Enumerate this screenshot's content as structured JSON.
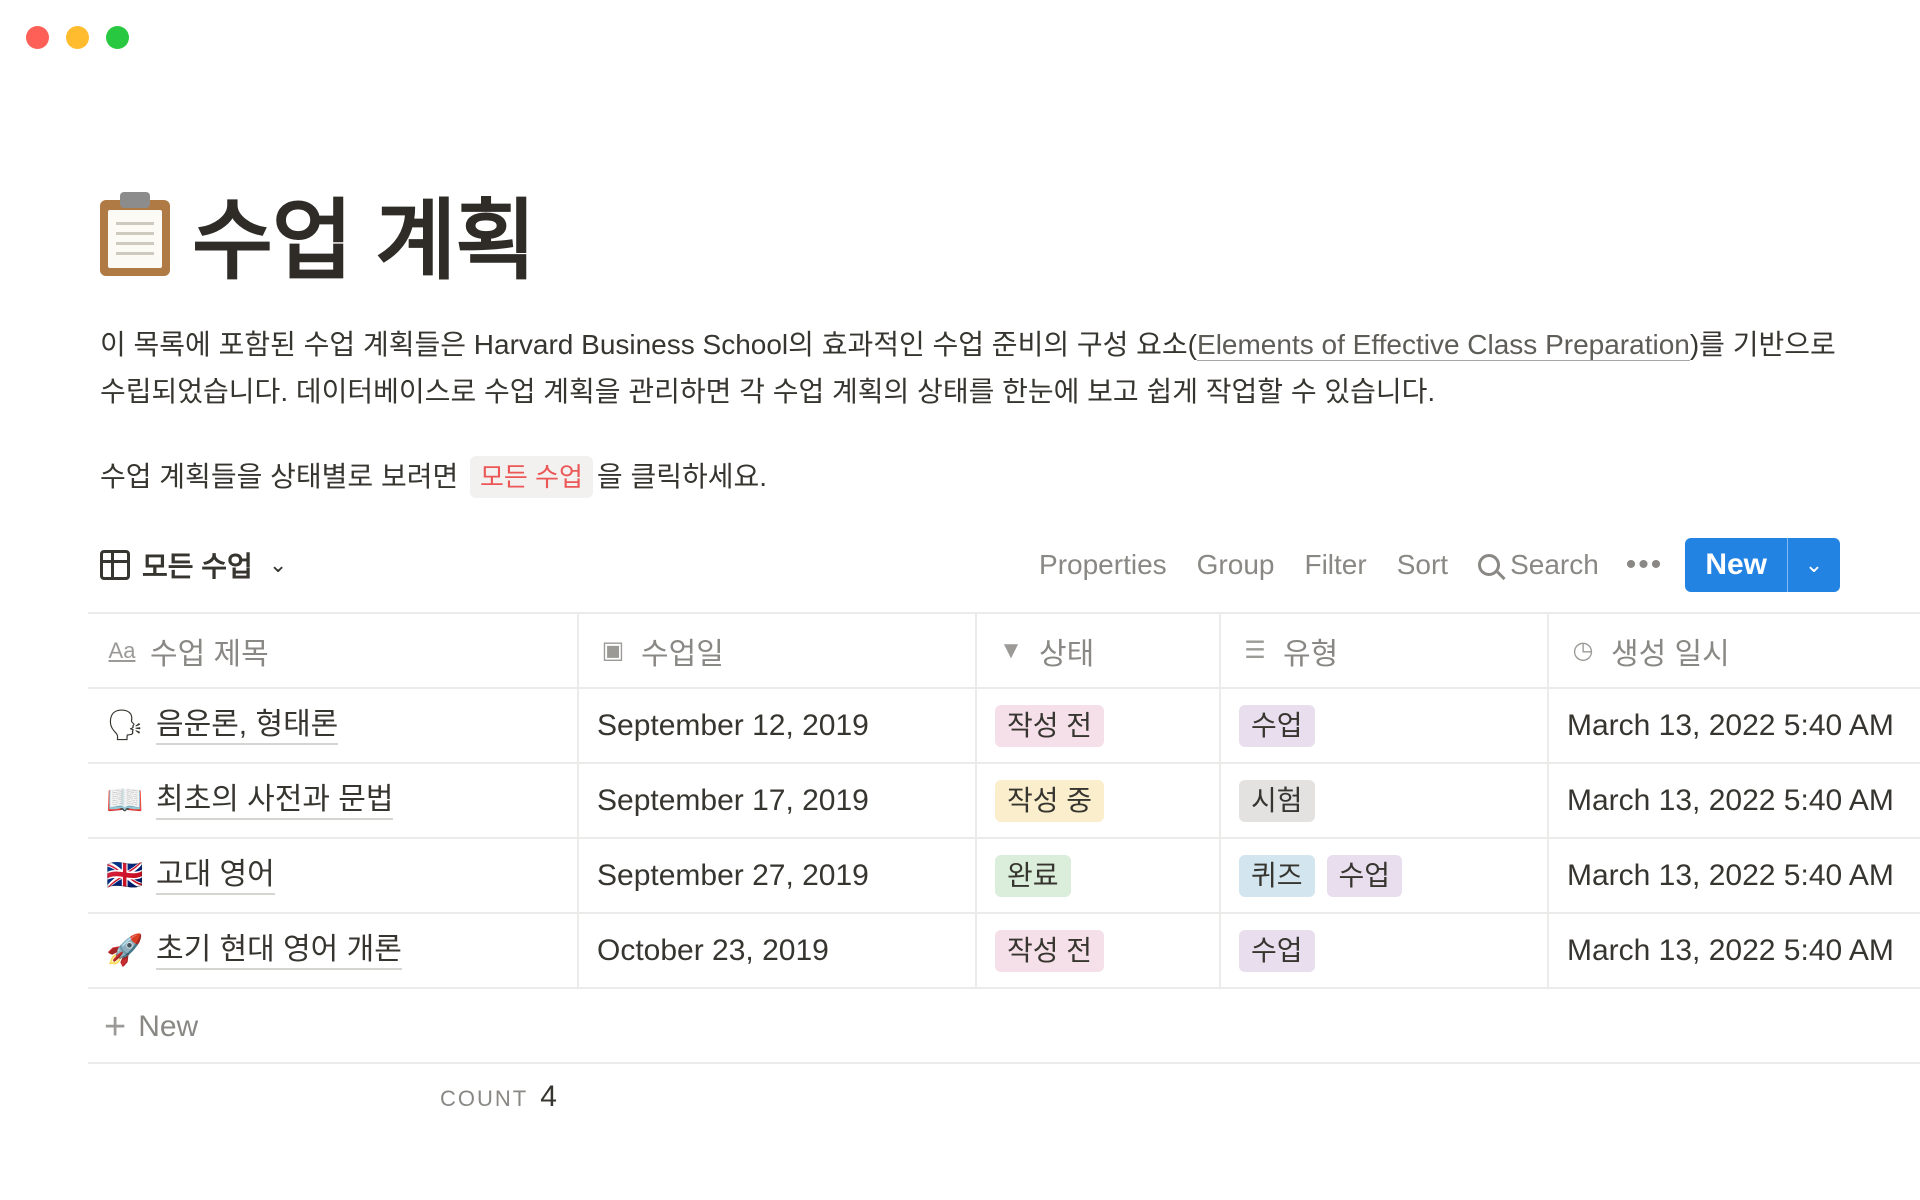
{
  "window": {
    "controls": [
      "close",
      "minimize",
      "maximize"
    ]
  },
  "page": {
    "icon": "clipboard-icon",
    "title": "수업 계획",
    "description_1": "이 목록에 포함된 수업 계획들은 Harvard Business School의 효과적인 수업 준비의 구성 요소(",
    "description_link": "Elements of Effective Class Preparation",
    "description_2": ")를 기반으로 수립되었습니다. 데이터베이스로 수업 계획을 관리하면 각 수업 계획의 상태를 한눈에 보고 쉽게 작업할 수 있습니다.",
    "hint_before": "수업 계획들을 상태별로 보려면",
    "hint_chip": "모든 수업",
    "hint_after": "을 클릭하세요."
  },
  "view": {
    "name": "모든 수업",
    "actions": {
      "properties": "Properties",
      "group": "Group",
      "filter": "Filter",
      "sort": "Sort",
      "search": "Search",
      "new": "New"
    }
  },
  "table": {
    "headers": [
      {
        "icon": "Aa",
        "label": "수업 제목"
      },
      {
        "icon": "calendar-icon",
        "label": "수업일"
      },
      {
        "icon": "status-icon",
        "label": "상태"
      },
      {
        "icon": "list-icon",
        "label": "유형"
      },
      {
        "icon": "clock-icon",
        "label": "생성 일시"
      }
    ],
    "rows": [
      {
        "emoji": "🗣",
        "title": "음운론, 형태론",
        "date": "September 12, 2019",
        "status": "작성 전",
        "types": [
          "수업"
        ],
        "created": "March 13, 2022 5:40 AM"
      },
      {
        "emoji": "📖",
        "title": "최초의 사전과 문법",
        "date": "September 17, 2019",
        "status": "작성 중",
        "types": [
          "시험"
        ],
        "created": "March 13, 2022 5:40 AM"
      },
      {
        "emoji": "🇬🇧",
        "title": "고대 영어",
        "date": "September 27, 2019",
        "status": "완료",
        "types": [
          "퀴즈",
          "수업"
        ],
        "created": "March 13, 2022 5:40 AM"
      },
      {
        "emoji": "🚀",
        "title": "초기 현대 영어 개론",
        "date": "October 23, 2019",
        "status": "작성 전",
        "types": [
          "수업"
        ],
        "created": "March 13, 2022 5:40 AM"
      }
    ],
    "new_row_label": "New",
    "count_label": "COUNT",
    "count_value": "4"
  },
  "colors": {
    "accent": "#2383e2",
    "chip_text": "#eb5757"
  }
}
